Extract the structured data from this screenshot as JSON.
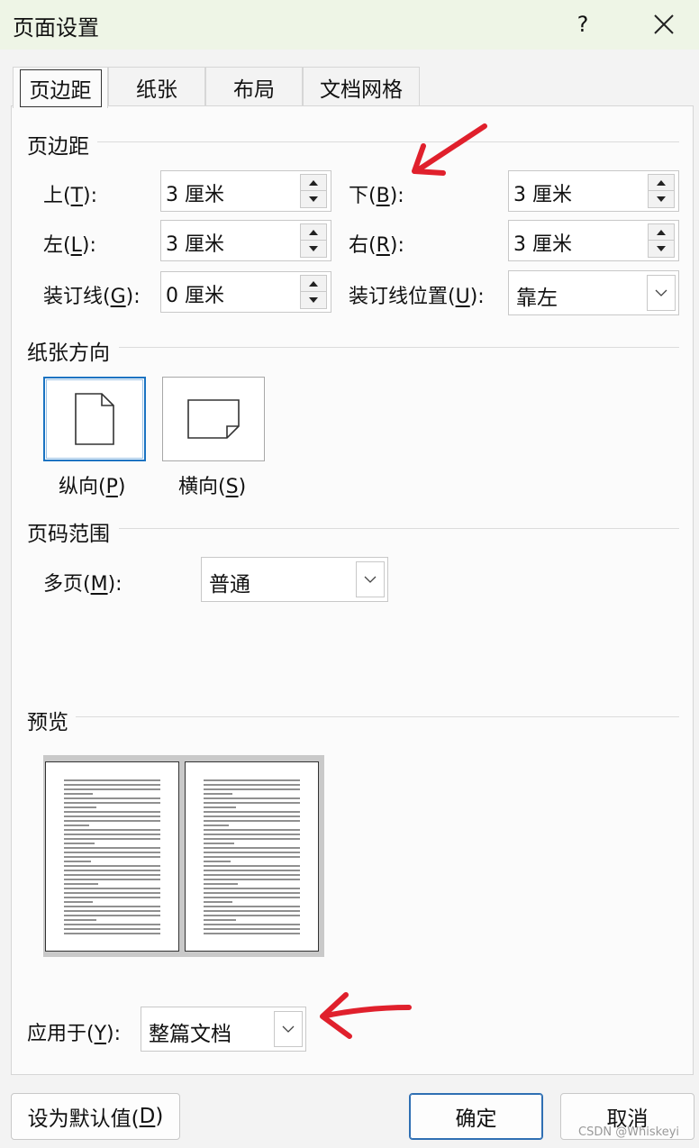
{
  "window": {
    "title": "页面设置",
    "help": "?"
  },
  "tabs": [
    "页边距",
    "纸张",
    "布局",
    "文档网格"
  ],
  "margins": {
    "heading": "页边距",
    "top": {
      "label": "上(",
      "key": "T",
      "tail": "):",
      "value": "3 厘米"
    },
    "bottom": {
      "label": "下(",
      "key": "B",
      "tail": "):",
      "value": "3 厘米"
    },
    "left": {
      "label": "左(",
      "key": "L",
      "tail": "):",
      "value": "3 厘米"
    },
    "right": {
      "label": "右(",
      "key": "R",
      "tail": "):",
      "value": "3 厘米"
    },
    "gutter": {
      "label": "装订线(",
      "key": "G",
      "tail": "):",
      "value": "0 厘米"
    },
    "gutter_pos": {
      "label": "装订线位置(",
      "key": "U",
      "tail": "):",
      "value": "靠左"
    }
  },
  "orientation": {
    "heading": "纸张方向",
    "portrait": {
      "label": "纵向(",
      "key": "P",
      "tail": ")"
    },
    "landscape": {
      "label": "横向(",
      "key": "S",
      "tail": ")"
    },
    "selected": "portrait"
  },
  "pages": {
    "heading": "页码范围",
    "multiple": {
      "label": "多页(",
      "key": "M",
      "tail": "):",
      "value": "普通"
    }
  },
  "preview": {
    "heading": "预览"
  },
  "apply": {
    "label": "应用于(",
    "key": "Y",
    "tail": "):",
    "value": "整篇文档"
  },
  "buttons": {
    "default": {
      "label": "设为默认值(",
      "key": "D",
      "tail": ")"
    },
    "ok": "确定",
    "cancel": "取消"
  },
  "watermark": "CSDN @Whiskeyi",
  "colors": {
    "title_bg": "#eef5e6",
    "annotation_arrow": "#e0202c",
    "selected_border": "#1a73c2"
  }
}
